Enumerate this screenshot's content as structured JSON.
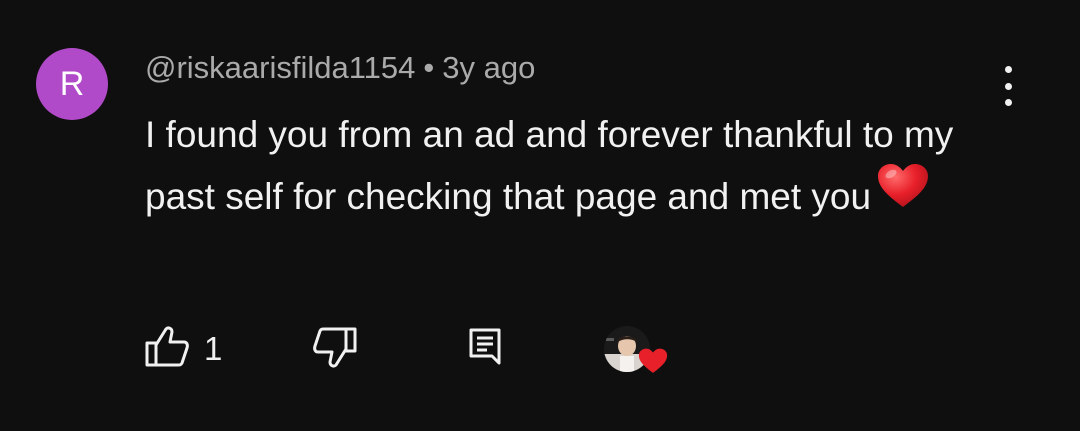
{
  "comment": {
    "avatar_letter": "R",
    "avatar_color": "#b04ac9",
    "author": "@riskaarisfilda1154",
    "separator": "•",
    "time": "3y ago",
    "text": "I found you from an ad and forever thankful to my past self for checking that page and met you",
    "emoji": "heart-emoji"
  },
  "actions": {
    "like_count": "1",
    "like_icon": "thumbs-up-icon",
    "dislike_icon": "thumbs-down-icon",
    "reply_icon": "reply-icon",
    "menu_icon": "more-vert-icon"
  },
  "colors": {
    "background": "#0f0f0f",
    "text": "#f1f1f1",
    "meta": "#aaaaaa",
    "heart": "#e8202a"
  }
}
